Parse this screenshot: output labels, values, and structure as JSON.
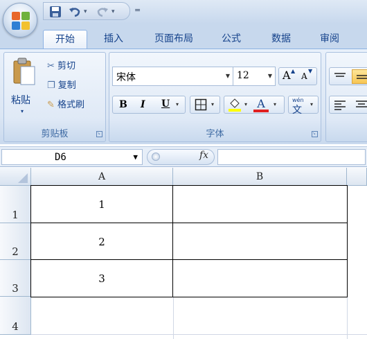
{
  "quick_access": {
    "customize_glyph": "="
  },
  "tabs": [
    {
      "label": "开始",
      "active": true
    },
    {
      "label": "插入",
      "active": false
    },
    {
      "label": "页面布局",
      "active": false
    },
    {
      "label": "公式",
      "active": false
    },
    {
      "label": "数据",
      "active": false
    },
    {
      "label": "审阅",
      "active": false
    }
  ],
  "clipboard": {
    "paste_label": "粘贴",
    "cut_label": "剪切",
    "copy_label": "复制",
    "format_painter_label": "格式刷",
    "group_label": "剪贴板"
  },
  "font": {
    "font_name": "宋体",
    "font_size": "12",
    "group_label": "字体",
    "bold_label": "B",
    "italic_label": "I",
    "underline_label": "U",
    "grow_label": "A",
    "shrink_label": "A",
    "font_color_label": "A",
    "phonetic_label": "wén",
    "phonetic_char": "文",
    "font_color": "#e02020",
    "fill_color": "#ffff00"
  },
  "formula_bar": {
    "name_box": "D6",
    "fx_label": "fx",
    "formula": ""
  },
  "sheet": {
    "columns": [
      "A",
      "B"
    ],
    "rows": [
      "1",
      "2",
      "3",
      "4"
    ],
    "cells": {
      "A1": "1",
      "A2": "2",
      "A3": "3"
    }
  },
  "colors": {
    "ribbon_bg": "#dbe6f4",
    "tab_text": "#15428b",
    "grid_line": "#d0d7e5"
  }
}
